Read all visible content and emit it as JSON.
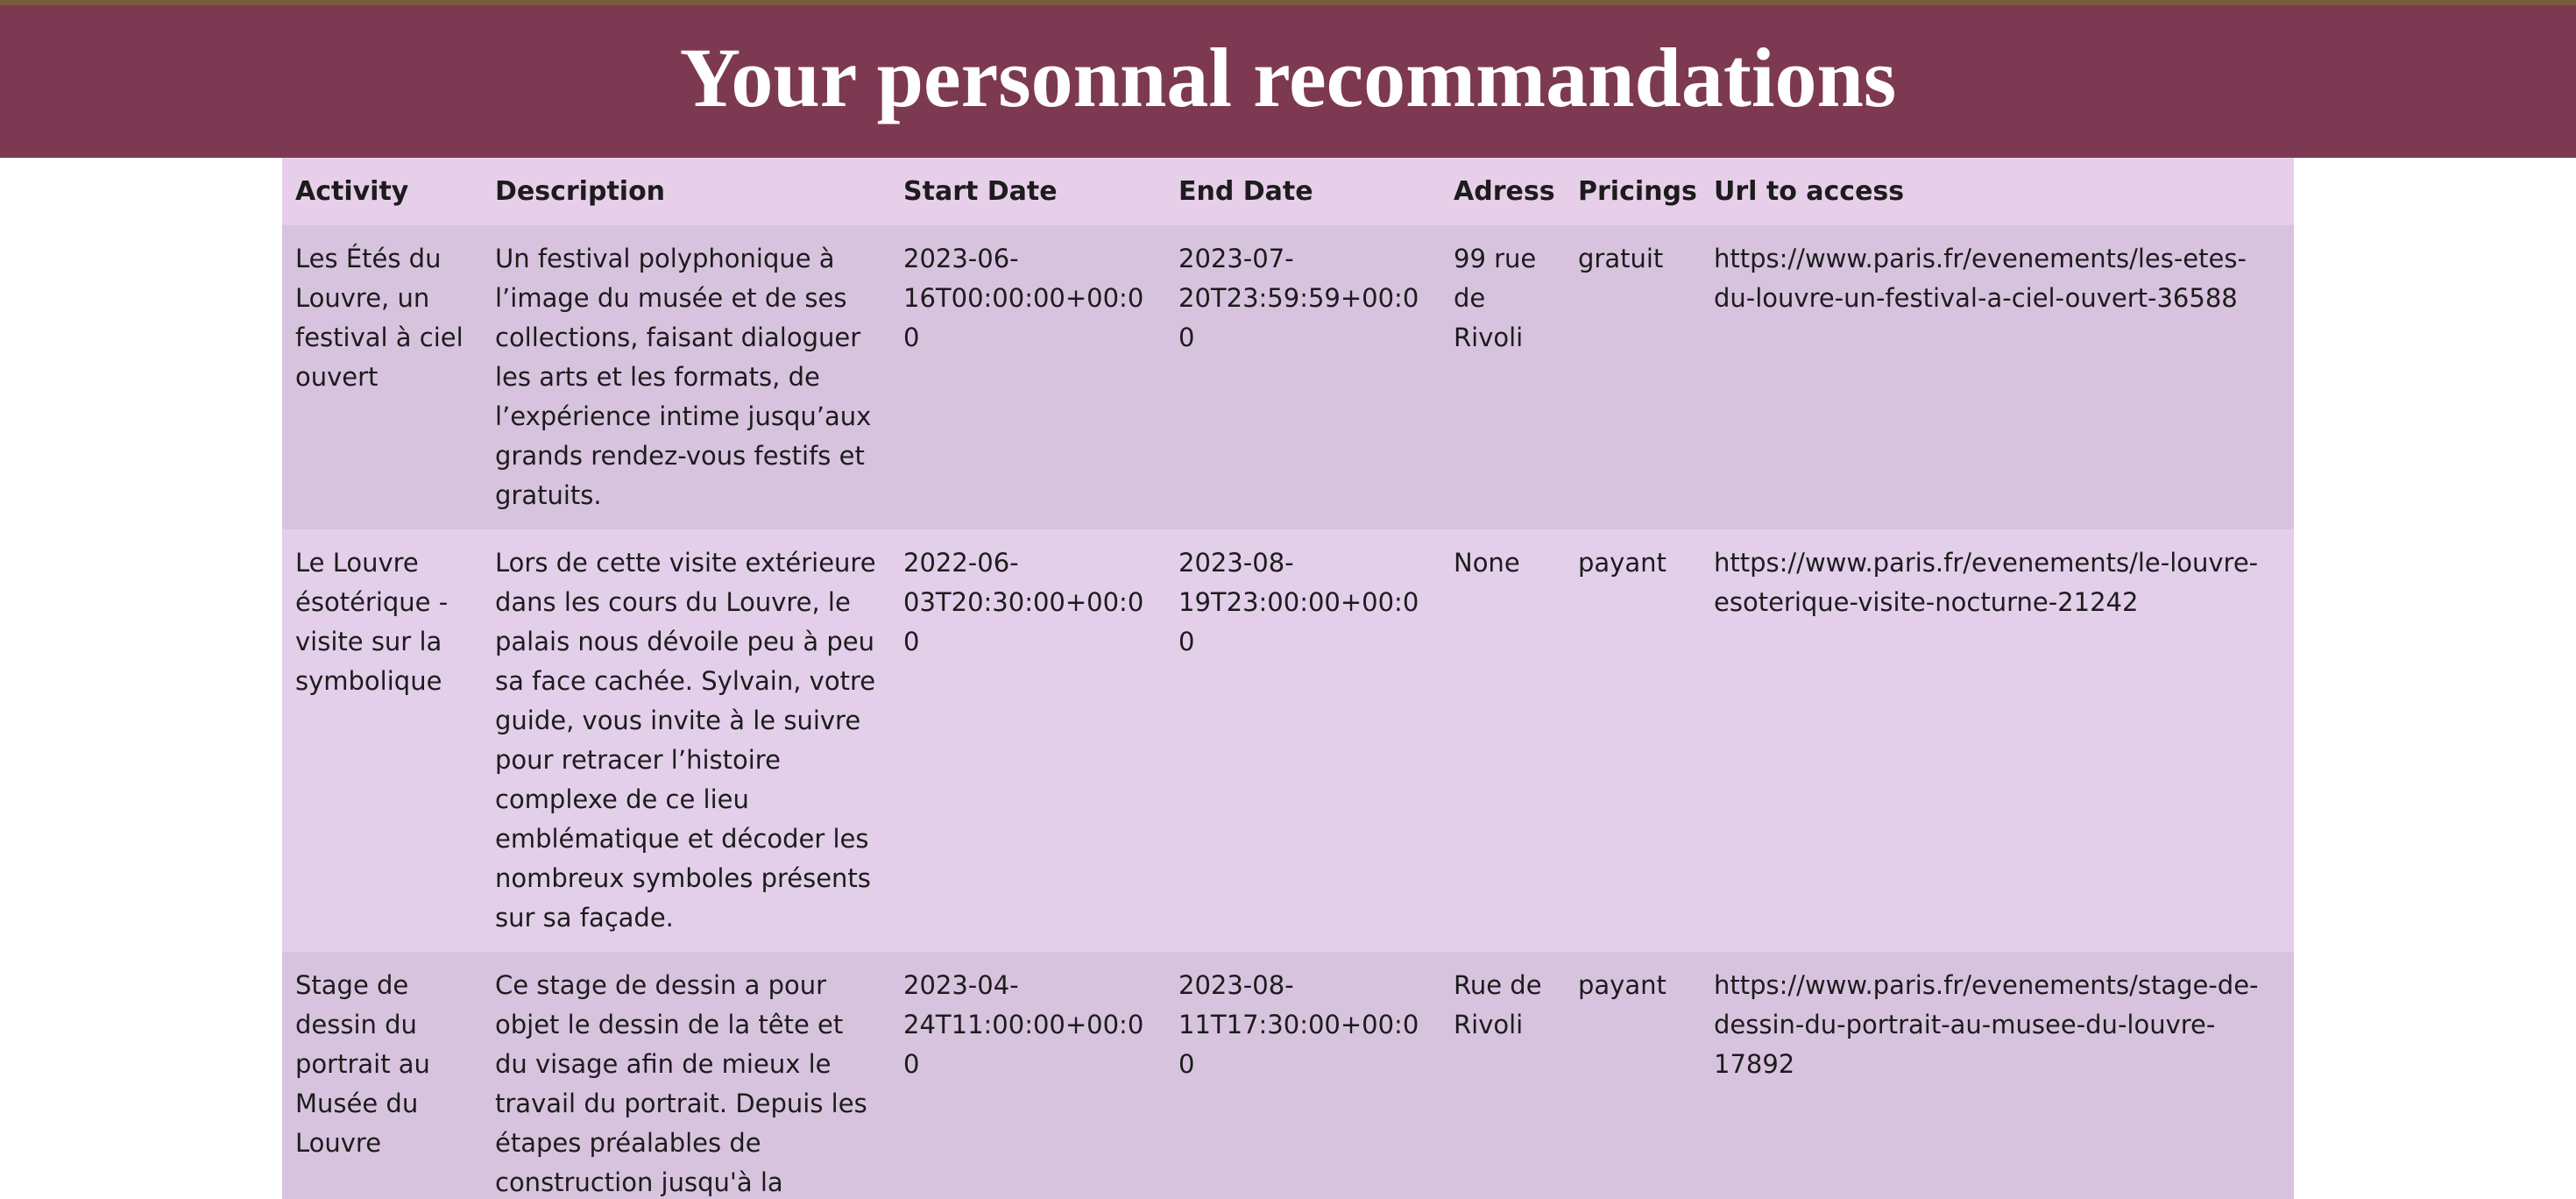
{
  "page": {
    "title": "Your personnal recommandations"
  },
  "table": {
    "headers": [
      "Activity",
      "Description",
      "Start Date",
      "End Date",
      "Adress",
      "Pricings",
      "Url to access"
    ],
    "rows": [
      {
        "activity": "Les Étés du Louvre, un festival à ciel ouvert",
        "description": "Un festival polyphonique à l’image du musée et de ses collections, faisant dialoguer les arts et les formats, de l’expérience intime jusqu’aux grands rendez-vous festifs et gratuits.",
        "start_date": "2023-06-16T00:00:00+00:00",
        "end_date": "2023-07-20T23:59:59+00:00",
        "address": "99 rue de Rivoli",
        "pricing": "gratuit",
        "url": "https://www.paris.fr/evenements/les-etes-du-louvre-un-festival-a-ciel-ouvert-36588"
      },
      {
        "activity": "Le Louvre ésotérique - visite sur la symbolique",
        "description": "Lors de cette visite extérieure dans les cours du Louvre, le palais nous dévoile peu à peu sa face cachée. Sylvain, votre guide, vous invite à le suivre pour retracer l’histoire complexe de ce lieu emblématique et décoder les nombreux symboles présents sur sa façade.",
        "start_date": "2022-06-03T20:30:00+00:00",
        "end_date": "2023-08-19T23:00:00+00:00",
        "address": "None",
        "pricing": "payant",
        "url": "https://www.paris.fr/evenements/le-louvre-esoterique-visite-nocturne-21242"
      },
      {
        "activity": "Stage de dessin du portrait au Musée du Louvre",
        "description": "Ce stage de dessin a pour objet le dessin de la tête et du visage afin de mieux le travail du portrait. Depuis les étapes préalables de construction jusqu'à la",
        "start_date": "2023-04-24T11:00:00+00:00",
        "end_date": "2023-08-11T17:30:00+00:00",
        "address": "Rue de Rivoli",
        "pricing": "payant",
        "url": "https://www.paris.fr/evenements/stage-de-dessin-du-portrait-au-musee-du-louvre-17892"
      }
    ]
  },
  "colors": {
    "header_bg": "#7d3951",
    "table_header_bg": "#e7cfea",
    "row_odd_bg": "#d8c3df",
    "row_even_bg": "#e3cfea"
  }
}
